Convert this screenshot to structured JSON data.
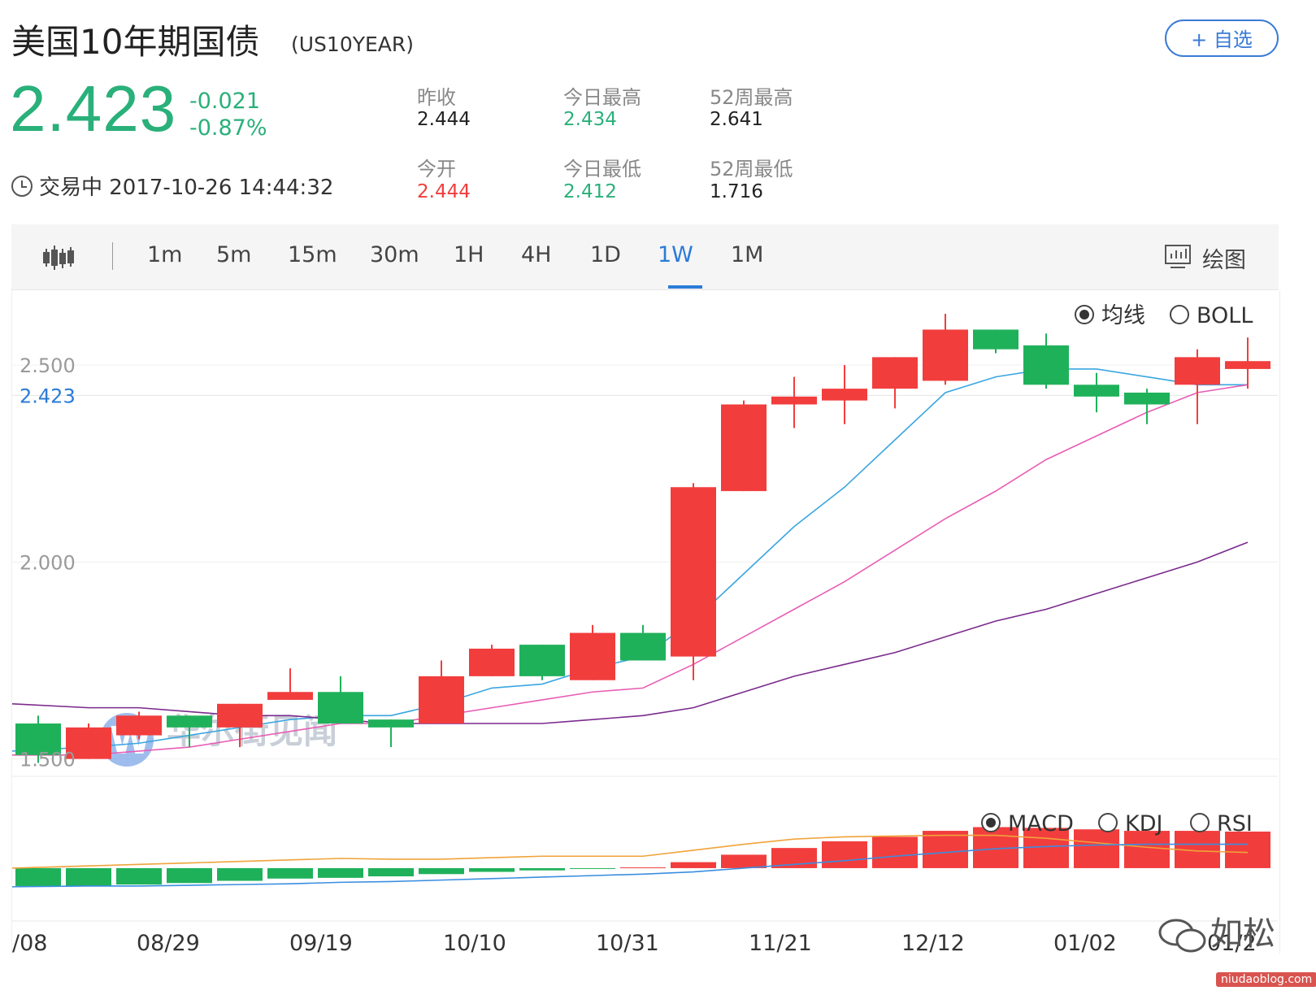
{
  "header": {
    "title": "美国10年期国债",
    "symbol": "(US10YEAR)",
    "add_button": "+ 自选"
  },
  "quote": {
    "price": "2.423",
    "change": "-0.021",
    "change_pct": "-0.87%",
    "status": "交易中 2017-10-26 14:44:32"
  },
  "stats": {
    "prev_close_label": "昨收",
    "prev_close": "2.444",
    "open_label": "今开",
    "open": "2.444",
    "day_high_label": "今日最高",
    "day_high": "2.434",
    "day_low_label": "今日最低",
    "day_low": "2.412",
    "wk52_high_label": "52周最高",
    "wk52_high": "2.641",
    "wk52_low_label": "52周最低",
    "wk52_low": "1.716"
  },
  "toolbar": {
    "timeframes": [
      "1m",
      "5m",
      "15m",
      "30m",
      "1H",
      "4H",
      "1D",
      "1W",
      "1M"
    ],
    "active": "1W",
    "draw_label": "绘图"
  },
  "overlay_options": {
    "ma": "均线",
    "boll": "BOLL",
    "selected": "均线"
  },
  "indicator_options": {
    "macd": "MACD",
    "kdj": "KDJ",
    "rsi": "RSI",
    "selected": "MACD"
  },
  "watermark": {
    "text": "华尔街见闻",
    "signature": "如松",
    "url": "niudaoblog.com"
  },
  "colors": {
    "up": "#f23d3d",
    "down": "#1fb15a",
    "accent": "#2b7bd8",
    "ma_blue": "#3aa6e0",
    "ma_pink": "#e85db5",
    "ma_purple": "#7a2a8c"
  },
  "chart_data": {
    "type": "candlestick",
    "interval": "1W",
    "y_ticks": [
      "2.500",
      "2.000",
      "1.500"
    ],
    "current_price_label": "2.423",
    "ylim": [
      1.46,
      2.69
    ],
    "x_tick_labels": [
      "/08",
      "08/29",
      "09/19",
      "10/10",
      "10/31",
      "11/21",
      "12/12",
      "01/02",
      "01/2"
    ],
    "candles": [
      {
        "o": 1.59,
        "c": 1.51,
        "h": 1.61,
        "l": 1.49
      },
      {
        "o": 1.5,
        "c": 1.58,
        "h": 1.59,
        "l": 1.5
      },
      {
        "o": 1.56,
        "c": 1.61,
        "h": 1.62,
        "l": 1.55
      },
      {
        "o": 1.61,
        "c": 1.58,
        "h": 1.61,
        "l": 1.53
      },
      {
        "o": 1.58,
        "c": 1.64,
        "h": 1.64,
        "l": 1.53
      },
      {
        "o": 1.65,
        "c": 1.67,
        "h": 1.73,
        "l": 1.65
      },
      {
        "o": 1.67,
        "c": 1.59,
        "h": 1.71,
        "l": 1.59
      },
      {
        "o": 1.6,
        "c": 1.58,
        "h": 1.6,
        "l": 1.53
      },
      {
        "o": 1.59,
        "c": 1.71,
        "h": 1.75,
        "l": 1.59
      },
      {
        "o": 1.71,
        "c": 1.78,
        "h": 1.79,
        "l": 1.71
      },
      {
        "o": 1.79,
        "c": 1.71,
        "h": 1.79,
        "l": 1.7
      },
      {
        "o": 1.7,
        "c": 1.82,
        "h": 1.84,
        "l": 1.7
      },
      {
        "o": 1.82,
        "c": 1.75,
        "h": 1.84,
        "l": 1.75
      },
      {
        "o": 1.76,
        "c": 2.19,
        "h": 2.2,
        "l": 1.7
      },
      {
        "o": 2.18,
        "c": 2.4,
        "h": 2.41,
        "l": 2.18
      },
      {
        "o": 2.4,
        "c": 2.42,
        "h": 2.47,
        "l": 2.34
      },
      {
        "o": 2.41,
        "c": 2.44,
        "h": 2.5,
        "l": 2.35
      },
      {
        "o": 2.44,
        "c": 2.52,
        "h": 2.52,
        "l": 2.39
      },
      {
        "o": 2.46,
        "c": 2.59,
        "h": 2.63,
        "l": 2.45
      },
      {
        "o": 2.59,
        "c": 2.54,
        "h": 2.59,
        "l": 2.53
      },
      {
        "o": 2.55,
        "c": 2.45,
        "h": 2.58,
        "l": 2.44
      },
      {
        "o": 2.45,
        "c": 2.42,
        "h": 2.48,
        "l": 2.38
      },
      {
        "o": 2.43,
        "c": 2.4,
        "h": 2.44,
        "l": 2.35
      },
      {
        "o": 2.45,
        "c": 2.52,
        "h": 2.54,
        "l": 2.35
      },
      {
        "o": 2.49,
        "c": 2.51,
        "h": 2.57,
        "l": 2.44
      }
    ],
    "ma_series": [
      {
        "color": "blue",
        "values": [
          1.52,
          1.53,
          1.54,
          1.56,
          1.58,
          1.6,
          1.61,
          1.61,
          1.64,
          1.68,
          1.69,
          1.73,
          1.76,
          1.85,
          1.97,
          2.09,
          2.19,
          2.31,
          2.43,
          2.47,
          2.49,
          2.49,
          2.47,
          2.45,
          2.45
        ]
      },
      {
        "color": "pink",
        "values": [
          1.51,
          1.51,
          1.52,
          1.53,
          1.55,
          1.57,
          1.59,
          1.59,
          1.61,
          1.63,
          1.65,
          1.67,
          1.68,
          1.74,
          1.81,
          1.88,
          1.95,
          2.03,
          2.11,
          2.18,
          2.26,
          2.32,
          2.38,
          2.43,
          2.45
        ]
      },
      {
        "color": "purple",
        "values": [
          1.64,
          1.63,
          1.63,
          1.62,
          1.61,
          1.61,
          1.6,
          1.59,
          1.59,
          1.59,
          1.59,
          1.6,
          1.61,
          1.63,
          1.67,
          1.71,
          1.74,
          1.77,
          1.81,
          1.85,
          1.88,
          1.92,
          1.96,
          2.0,
          2.05
        ]
      }
    ],
    "macd": {
      "ylim": [
        -0.06,
        0.11
      ],
      "histogram": [
        -0.024,
        -0.024,
        -0.022,
        -0.02,
        -0.017,
        -0.014,
        -0.013,
        -0.011,
        -0.008,
        -0.005,
        -0.003,
        -0.001,
        0.001,
        0.008,
        0.018,
        0.027,
        0.036,
        0.042,
        0.05,
        0.055,
        0.054,
        0.052,
        0.05,
        0.05,
        0.049
      ],
      "dif": [
        0.0,
        0.003,
        0.005,
        0.007,
        0.009,
        0.011,
        0.013,
        0.012,
        0.012,
        0.014,
        0.016,
        0.016,
        0.016,
        0.024,
        0.032,
        0.039,
        0.042,
        0.043,
        0.044,
        0.044,
        0.04,
        0.034,
        0.028,
        0.023,
        0.021
      ],
      "dea": [
        -0.025,
        -0.024,
        -0.024,
        -0.023,
        -0.022,
        -0.021,
        -0.019,
        -0.018,
        -0.016,
        -0.014,
        -0.012,
        -0.01,
        -0.008,
        -0.005,
        0.0,
        0.005,
        0.01,
        0.016,
        0.021,
        0.026,
        0.029,
        0.031,
        0.032,
        0.032,
        0.032
      ]
    }
  }
}
